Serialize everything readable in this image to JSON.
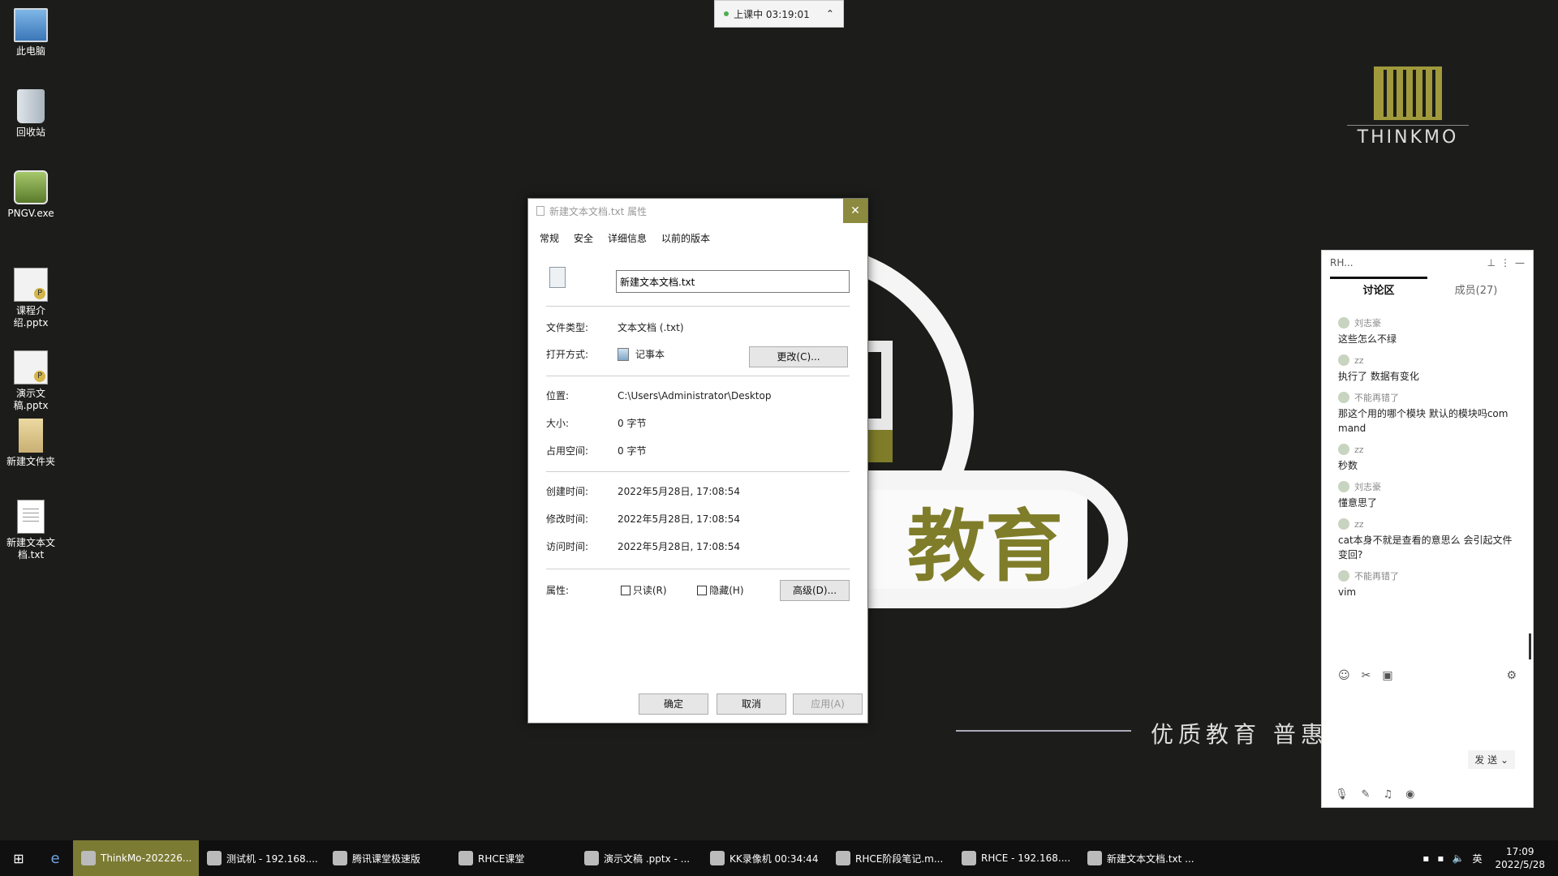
{
  "desktop": {
    "icons": [
      {
        "label": "此电脑",
        "icon": "computer-icon"
      },
      {
        "label": "回收站",
        "icon": "recycle-bin-icon"
      },
      {
        "label": "PNGV.exe",
        "icon": "png-viewer-icon"
      },
      {
        "label": "课程介绍.pptx",
        "icon": "pptx-file-icon"
      },
      {
        "label": "演示文稿.pptx",
        "icon": "pptx-file-icon"
      },
      {
        "label": "新建文件夹",
        "icon": "folder-icon"
      },
      {
        "label": "新建文本文档.txt",
        "icon": "txt-file-icon"
      }
    ]
  },
  "meeting_bar": {
    "status": "上课中 03:19:01"
  },
  "background": {
    "logo_text": "THINKMO",
    "slogan_big": "教育",
    "slogan_small": "优质教育  普惠"
  },
  "dialog": {
    "title": "新建文本文档.txt 属性",
    "close_glyph": "✕",
    "tabs": [
      "常规",
      "安全",
      "详细信息",
      "以前的版本"
    ],
    "filename": "新建文本文档.txt",
    "file_type_label": "文件类型:",
    "file_type": "文本文档 (.txt)",
    "open_with_label": "打开方式:",
    "open_with": "记事本",
    "change_button": "更改(C)...",
    "location_label": "位置:",
    "location": "C:\\Users\\Administrator\\Desktop",
    "size_label": "大小:",
    "size": "0 字节",
    "size_on_disk_label": "占用空间:",
    "size_on_disk": "0 字节",
    "created_label": "创建时间:",
    "created": "2022年5月28日, 17:08:54",
    "modified_label": "修改时间:",
    "modified": "2022年5月28日, 17:08:54",
    "accessed_label": "访问时间:",
    "accessed": "2022年5月28日, 17:08:54",
    "attributes_label": "属性:",
    "readonly_label": "只读(R)",
    "hidden_label": "隐藏(H)",
    "advanced_button": "高级(D)...",
    "ok_button": "确定",
    "cancel_button": "取消",
    "apply_button": "应用(A)"
  },
  "chat": {
    "title": "RH...",
    "tab_discussion": "讨论区",
    "tab_members": "成员(27)",
    "messages": [
      {
        "user": "刘志豪",
        "text": "这些怎么不绿"
      },
      {
        "user": "zz",
        "text": "执行了 数据有变化"
      },
      {
        "user": "不能再错了",
        "text": "那这个用的哪个模块 默认的模块吗command"
      },
      {
        "user": "zz",
        "text": "秒数"
      },
      {
        "user": "刘志豪",
        "text": "懂意思了"
      },
      {
        "user": "zz",
        "text": "cat本身不就是查看的意思么 会引起文件变回?"
      },
      {
        "user": "不能再错了",
        "text": "vim"
      }
    ],
    "send_label": "发 送"
  },
  "taskbar": {
    "items": [
      {
        "label": "ThinkMo-202226...",
        "active": true
      },
      {
        "label": "测试机 - 192.168....",
        "active": false
      },
      {
        "label": "腾讯课堂极速版",
        "active": false
      },
      {
        "label": "RHCE课堂",
        "active": false
      },
      {
        "label": "演示文稿 .pptx - ...",
        "active": false
      },
      {
        "label": "KK录像机 00:34:44",
        "active": false
      },
      {
        "label": "RHCE阶段笔记.m...",
        "active": false
      },
      {
        "label": "RHCE - 192.168....",
        "active": false
      },
      {
        "label": "新建文本文档.txt ...",
        "active": false
      }
    ],
    "ime": "英",
    "time": "17:09",
    "date": "2022/5/28"
  }
}
